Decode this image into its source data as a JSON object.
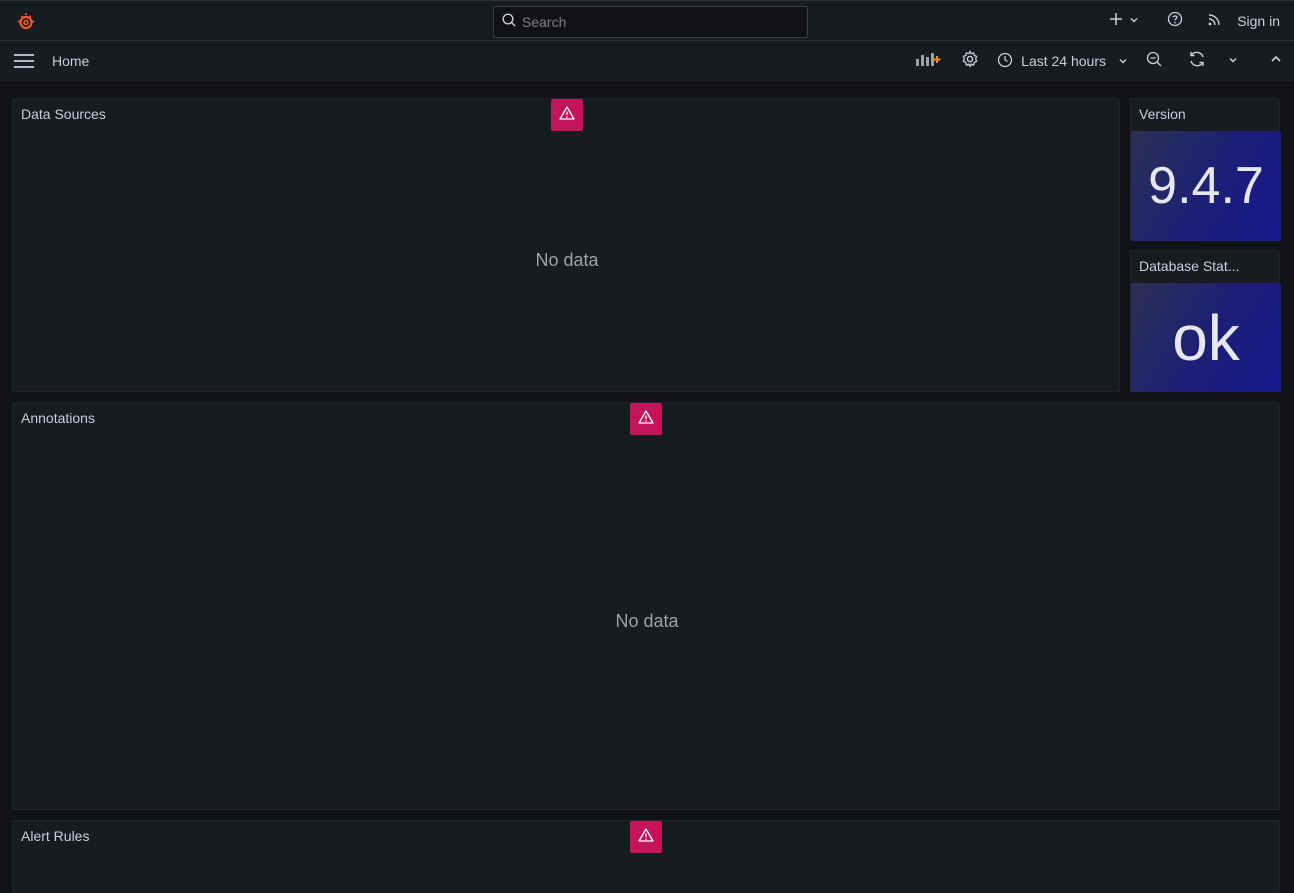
{
  "topbar": {
    "search_placeholder": "Search",
    "sign_in": "Sign in"
  },
  "subbar": {
    "breadcrumb": "Home",
    "time_range": "Last 24 hours"
  },
  "panels": {
    "data_sources": {
      "title": "Data Sources",
      "empty": "No data"
    },
    "version": {
      "title": "Version",
      "value": "9.4.7"
    },
    "database_status": {
      "title": "Database Stat...",
      "value": "ok"
    },
    "annotations": {
      "title": "Annotations",
      "empty": "No data"
    },
    "alert_rules": {
      "title": "Alert Rules"
    }
  },
  "colors": {
    "background": "#111217",
    "panel": "#181b1f",
    "alert": "#c4145a",
    "logo": "#f05a28",
    "stat_gradient_start": "#2b3154",
    "stat_gradient_end": "#161a8c"
  },
  "icons": [
    "grafana-logo-icon",
    "search-icon",
    "plus-icon",
    "chevron-down-icon",
    "help-icon",
    "rss-icon",
    "hamburger-icon",
    "add-panel-icon",
    "gear-icon",
    "clock-icon",
    "zoom-out-icon",
    "refresh-icon",
    "chevron-up-icon",
    "warning-icon"
  ]
}
